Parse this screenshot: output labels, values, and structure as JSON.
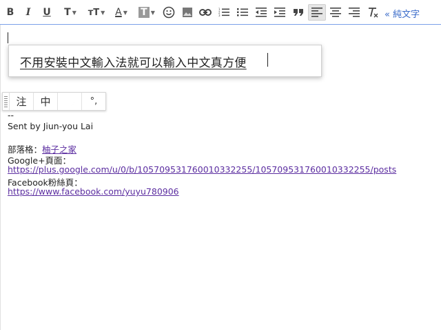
{
  "toolbar": {
    "bold": "B",
    "italic": "I",
    "underline": "U",
    "font_family": "T",
    "font_size": "тT",
    "text_color": "A",
    "highlight": "T",
    "plain_text_label": "« 純文字"
  },
  "editor": {
    "ime_candidate": "不用安裝中文輸入法就可以輸入中文真方便",
    "ime_bar": {
      "mode_zhuyin": "注",
      "mode_chinese": "中",
      "mode_punct": "°,"
    },
    "signature": {
      "separator": "--",
      "sent_by": "Sent by Jiun-you Lai",
      "blog_label": "部落格：",
      "blog_link": "柚子之家",
      "gplus_label": "Google+頁面：",
      "gplus_url": "https://plus.google.com/u/0/b/105709531760010332255/105709531760010332255/posts",
      "fb_label": "Facebook粉絲頁：",
      "fb_url": "https://www.facebook.com/yuyu780906"
    }
  },
  "colors": {
    "link": "#5b2da0",
    "plain_text_link": "#3a6bc9",
    "toolbar_border": "#7aa0e8"
  }
}
